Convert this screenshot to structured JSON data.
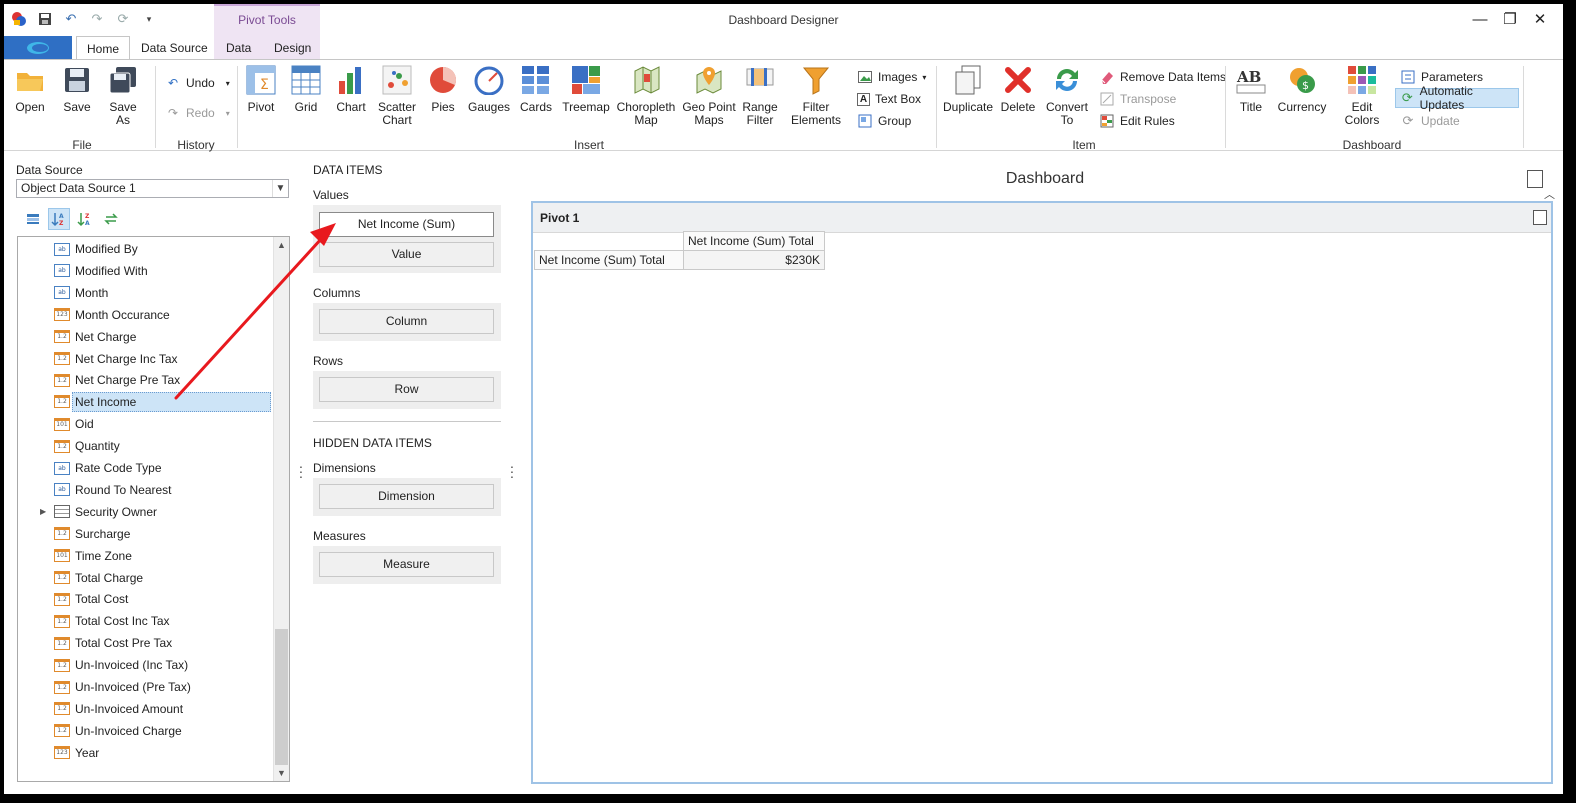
{
  "window": {
    "title": "Dashboard Designer",
    "contextual_group": "Pivot Tools",
    "controls": [
      "—",
      "❐",
      "✕"
    ]
  },
  "tabs": {
    "home": "Home",
    "data_source": "Data Source",
    "data": "Data",
    "design": "Design"
  },
  "ribbon": {
    "file": {
      "open": "Open",
      "save": "Save",
      "save_as": "Save As",
      "group": "File"
    },
    "history": {
      "undo": "Undo",
      "redo": "Redo",
      "group": "History"
    },
    "insert": {
      "pivot": "Pivot",
      "grid": "Grid",
      "chart": "Chart",
      "scatter": "Scatter\nChart",
      "pies": "Pies",
      "gauges": "Gauges",
      "cards": "Cards",
      "treemap": "Treemap",
      "choropleth": "Choropleth\nMap",
      "geo_point": "Geo Point\nMaps",
      "range_filter": "Range\nFilter",
      "filter_elements": "Filter\nElements",
      "images": "Images",
      "text_box": "Text Box",
      "group_btn": "Group",
      "group": "Insert"
    },
    "item": {
      "duplicate": "Duplicate",
      "delete": "Delete",
      "convert": "Convert\nTo",
      "remove_data_items": "Remove Data Items",
      "transpose": "Transpose",
      "edit_rules": "Edit Rules",
      "group": "Item"
    },
    "dashboard": {
      "title": "Title",
      "currency": "Currency",
      "edit_colors": "Edit Colors",
      "parameters": "Parameters",
      "automatic_updates": "Automatic Updates",
      "update": "Update",
      "group": "Dashboard"
    }
  },
  "data_source": {
    "label": "Data Source",
    "selected": "Object Data Source 1",
    "fields": [
      {
        "name": "Modified By",
        "type": "ab"
      },
      {
        "name": "Modified With",
        "type": "ab"
      },
      {
        "name": "Month",
        "type": "ab"
      },
      {
        "name": "Month Occurance",
        "type": "123"
      },
      {
        "name": "Net Charge",
        "type": "1.2"
      },
      {
        "name": "Net Charge Inc Tax",
        "type": "1.2"
      },
      {
        "name": "Net Charge Pre Tax",
        "type": "1.2"
      },
      {
        "name": "Net Income",
        "type": "1.2"
      },
      {
        "name": "Oid",
        "type": "101"
      },
      {
        "name": "Quantity",
        "type": "1.2"
      },
      {
        "name": "Rate Code Type",
        "type": "ab"
      },
      {
        "name": "Round To Nearest",
        "type": "ab"
      },
      {
        "name": "Security Owner",
        "type": "tbl"
      },
      {
        "name": "Surcharge",
        "type": "1.2"
      },
      {
        "name": "Time Zone",
        "type": "101"
      },
      {
        "name": "Total Charge",
        "type": "1.2"
      },
      {
        "name": "Total Cost",
        "type": "1.2"
      },
      {
        "name": "Total Cost Inc Tax",
        "type": "1.2"
      },
      {
        "name": "Total Cost Pre Tax",
        "type": "1.2"
      },
      {
        "name": "Un-Invoiced (Inc Tax)",
        "type": "1.2"
      },
      {
        "name": "Un-Invoiced (Pre Tax)",
        "type": "1.2"
      },
      {
        "name": "Un-Invoiced Amount",
        "type": "1.2"
      },
      {
        "name": "Un-Invoiced Charge",
        "type": "1.2"
      },
      {
        "name": "Year",
        "type": "123"
      }
    ],
    "selected_field": "Net Income"
  },
  "data_items": {
    "header": "DATA ITEMS",
    "values_label": "Values",
    "values_item": "Net Income (Sum)",
    "values_placeholder": "Value",
    "columns_label": "Columns",
    "columns_placeholder": "Column",
    "rows_label": "Rows",
    "rows_placeholder": "Row",
    "hidden_header": "HIDDEN DATA ITEMS",
    "dimensions_label": "Dimensions",
    "dimensions_placeholder": "Dimension",
    "measures_label": "Measures",
    "measures_placeholder": "Measure"
  },
  "dashboard": {
    "title": "Dashboard",
    "pivot": {
      "title": "Pivot 1",
      "column_header": "Net Income (Sum) Total",
      "row_header": "Net Income (Sum) Total",
      "value": "$230K"
    }
  },
  "colors": {
    "file_tab": "#2f6fc4",
    "context_group": "#efe4f3",
    "selection": "#cde4f7",
    "arrow": "#e8191e"
  }
}
